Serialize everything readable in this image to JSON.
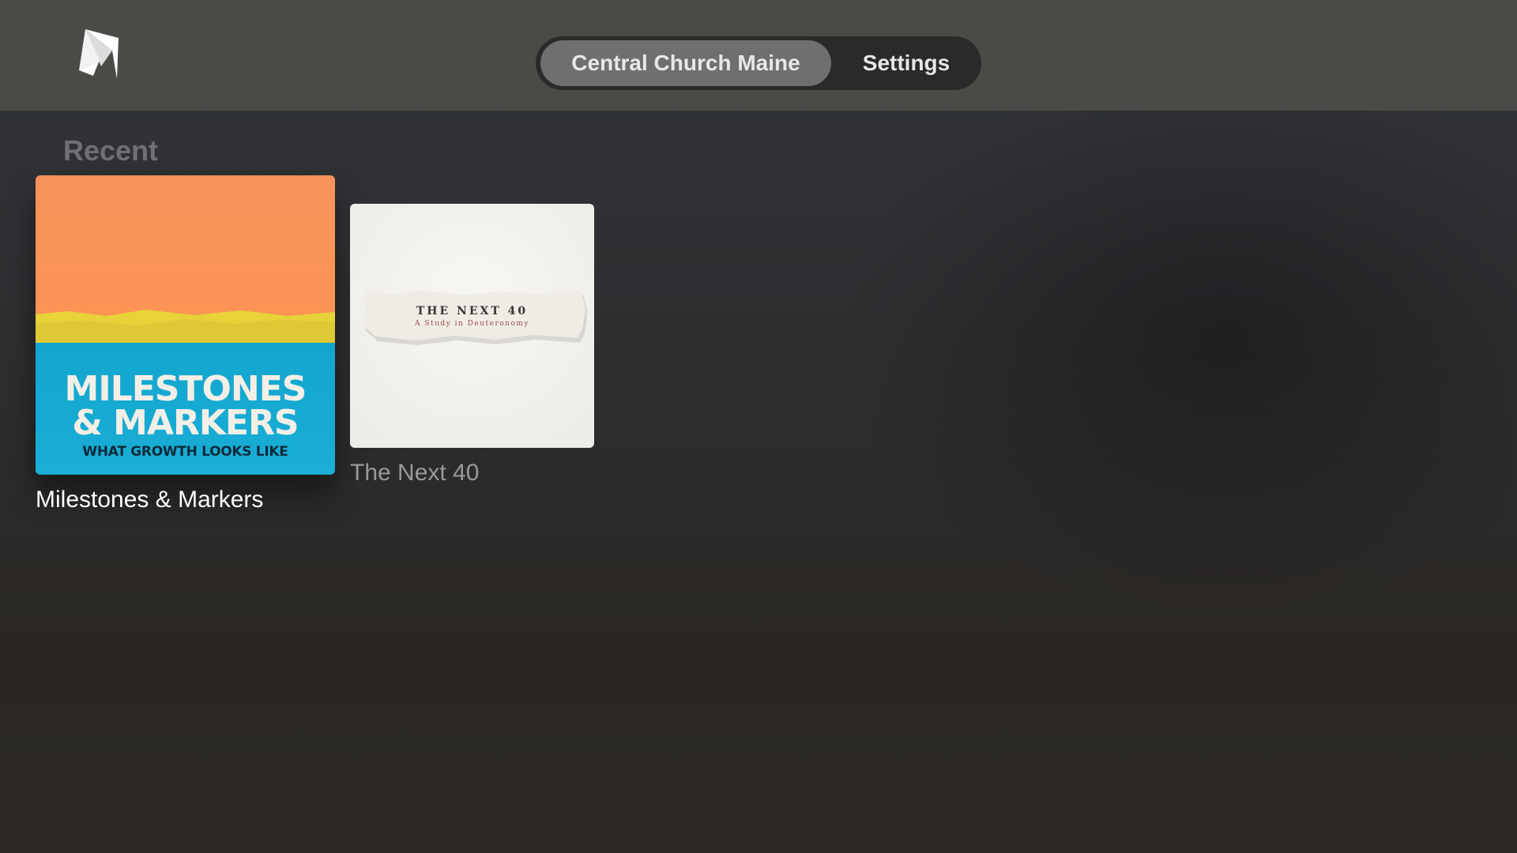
{
  "header": {
    "logo_icon": "app-logo-icon",
    "tabs": [
      {
        "label": "Central Church Maine",
        "selected": true
      },
      {
        "label": "Settings",
        "selected": false
      }
    ]
  },
  "recent": {
    "title": "Recent",
    "items": [
      {
        "title": "Milestones & Markers",
        "art": {
          "line1": "MILESTONES",
          "line2": "& MARKERS",
          "subtitle": "WHAT GROWTH LOOKS LIKE"
        },
        "focused": true
      },
      {
        "title": "The Next 40",
        "art": {
          "title": "THE NEXT 40",
          "subtitle": "A Study in Deuteronomy"
        },
        "focused": false
      }
    ]
  },
  "colors": {
    "topbar": "#4a4a46",
    "tab_active": "#6f6f6f",
    "tab_track": "#2a2a2a",
    "section_title": "#6e7075",
    "art_orange": "#fb9455",
    "art_yellow": "#e9d63a",
    "art_blue": "#14a8d1"
  }
}
